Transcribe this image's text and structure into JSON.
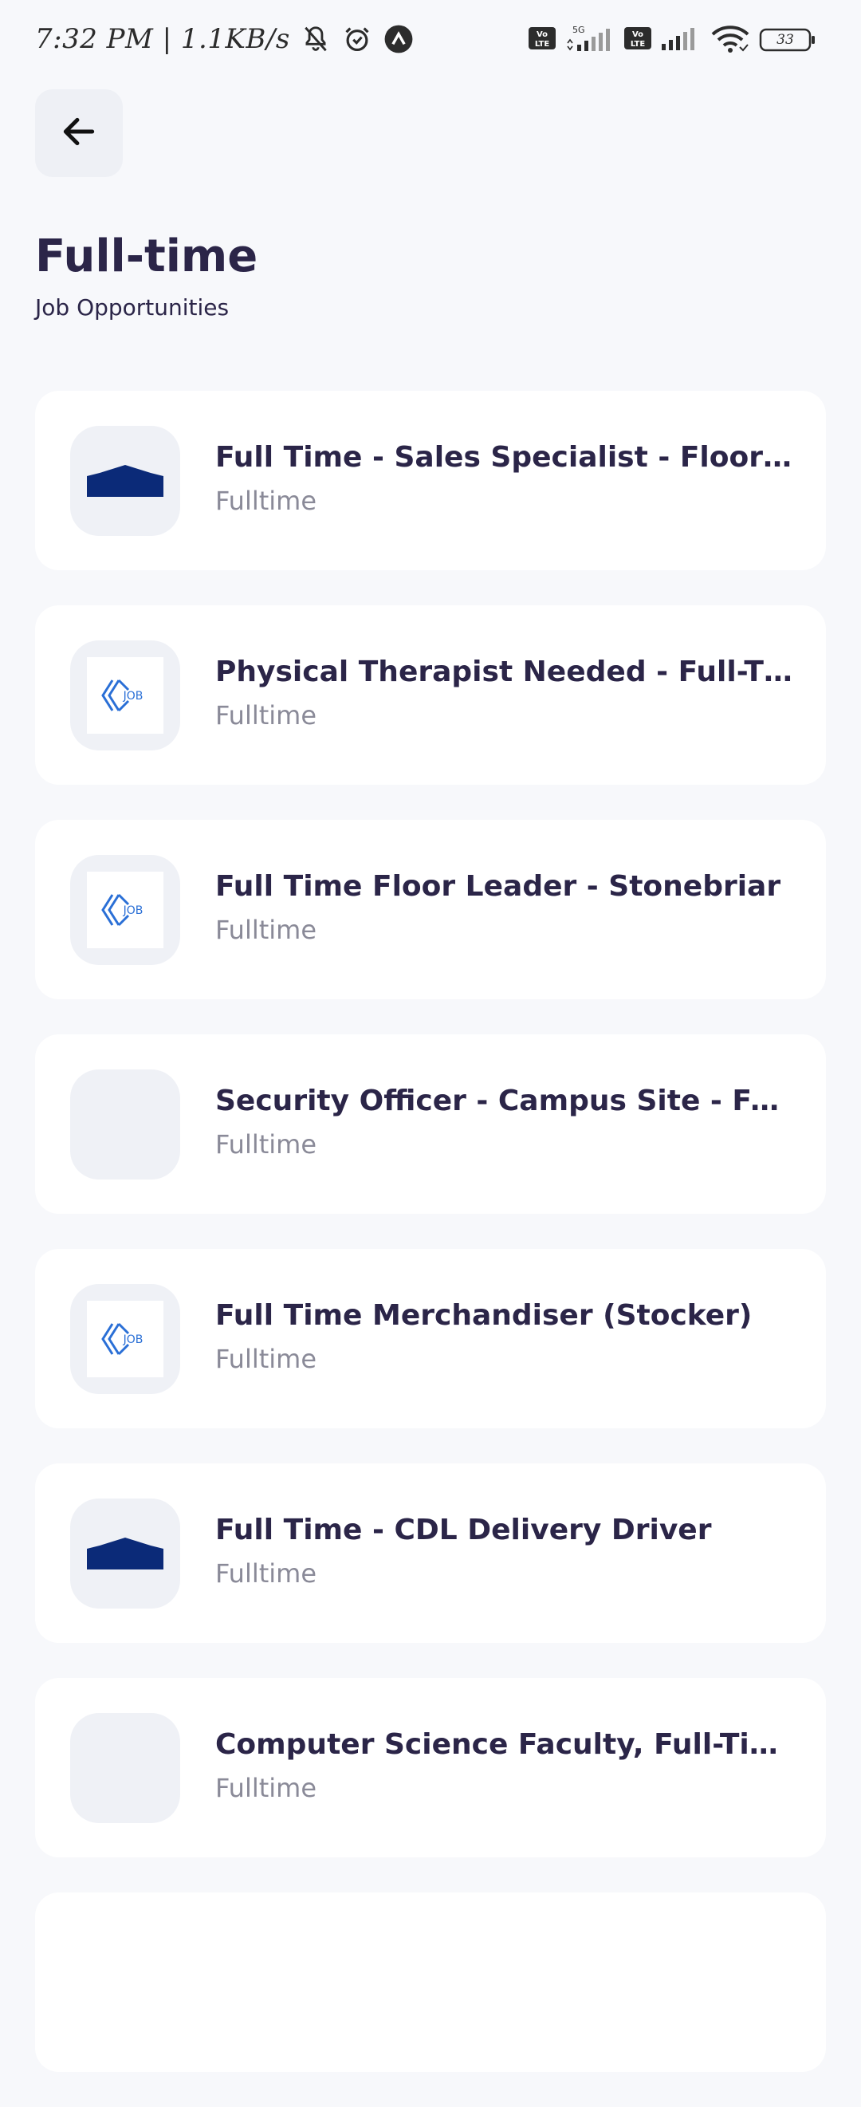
{
  "status_bar": {
    "time": "7:32 PM | 1.1KB/s",
    "battery": "33",
    "icons": [
      "mute-bell-icon",
      "alarm-icon",
      "app-notification-icon",
      "volte-icon",
      "signal-5g-icon",
      "volte-icon",
      "signal-icon",
      "wifi-icon",
      "battery-icon"
    ]
  },
  "header": {
    "back_icon": "arrow-left-icon",
    "title": "Full-time",
    "subtitle": "Job Opportunities"
  },
  "jobs": [
    {
      "title": "Full Time - Sales Specialist - Flooring",
      "type": "Fulltime",
      "logo": "house-roof-logo"
    },
    {
      "title": "Physical Therapist Needed - Full-Ti...",
      "type": "Fulltime",
      "logo": "job-logo"
    },
    {
      "title": "Full Time Floor Leader - Stonebriar",
      "type": "Fulltime",
      "logo": "job-logo"
    },
    {
      "title": "Security Officer - Campus Site - Fu...",
      "type": "Fulltime",
      "logo": "empty-logo"
    },
    {
      "title": "Full Time Merchandiser (Stocker)",
      "type": "Fulltime",
      "logo": "job-logo"
    },
    {
      "title": "Full Time - CDL Delivery Driver",
      "type": "Fulltime",
      "logo": "house-roof-logo"
    },
    {
      "title": "Computer Science Faculty, Full-Tim...",
      "type": "Fulltime",
      "logo": "empty-logo"
    }
  ],
  "colors": {
    "background": "#f7f8fb",
    "card": "#ffffff",
    "title_text": "#2b2548",
    "secondary_text": "#8a8a98",
    "logo_navy": "#0b2a78",
    "logo_blue": "#2a6fd6"
  }
}
